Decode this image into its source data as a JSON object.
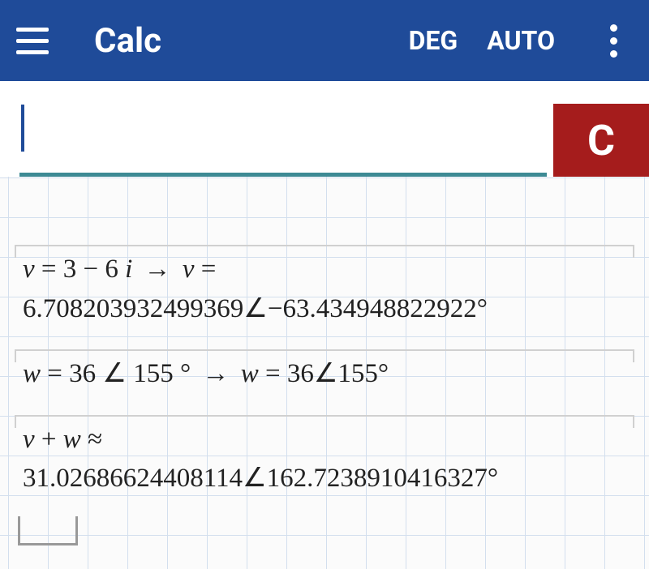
{
  "header": {
    "title": "Calc",
    "angle_mode": "DEG",
    "display_mode": "AUTO"
  },
  "input": {
    "value": "",
    "clear_label": "C"
  },
  "expressions": [
    {
      "input_var": "v",
      "input_expr": "3 − 6",
      "input_imag": "i",
      "result_var": "v",
      "result_mag": "6.708203932499369",
      "result_angle": "−63.434948822922°"
    },
    {
      "input_var": "w",
      "input_mag": "36",
      "input_angle": "155 °",
      "result_var": "w",
      "result_mag": "36",
      "result_angle": "155°"
    },
    {
      "input_expr_left": "v",
      "input_op": "+",
      "input_expr_right": "w",
      "approx": "≈",
      "result_mag": "31.02686624408114",
      "result_angle": "162.7238910416327°"
    }
  ]
}
